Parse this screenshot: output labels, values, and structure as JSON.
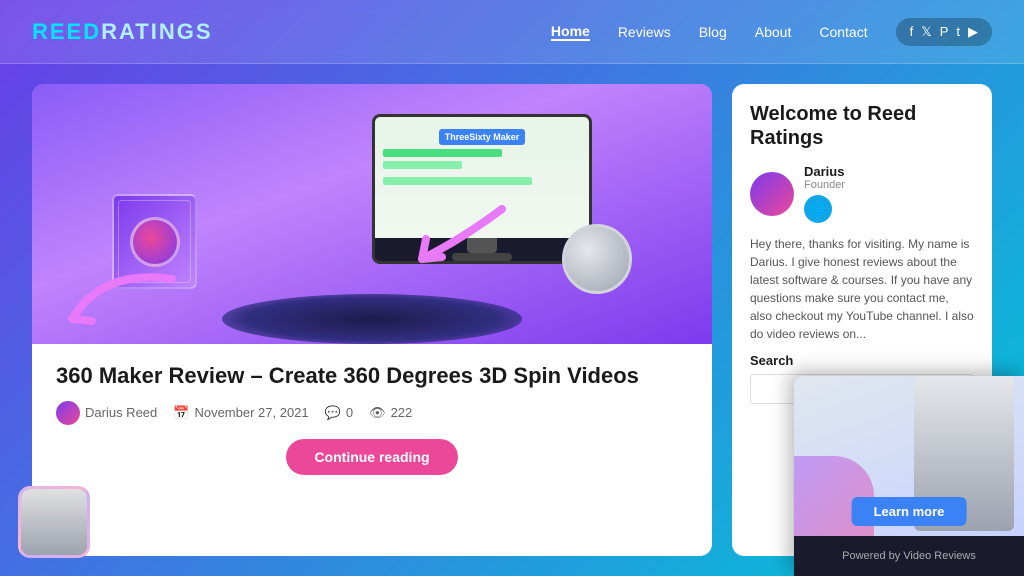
{
  "header": {
    "logo_text": "ReedRatings",
    "logo_part1": "Reed",
    "logo_part2": "Ratings",
    "nav": {
      "items": [
        {
          "label": "Home",
          "active": true
        },
        {
          "label": "Reviews",
          "active": false
        },
        {
          "label": "Blog",
          "active": false
        },
        {
          "label": "About",
          "active": false
        },
        {
          "label": "Contact",
          "active": false
        }
      ]
    },
    "social": [
      "f",
      "t",
      "𝐏",
      "t",
      "▶"
    ]
  },
  "article": {
    "title": "360 Maker Review – Create 360 Degrees 3D Spin Videos",
    "author": "Darius Reed",
    "date": "November 27, 2021",
    "comments": "0",
    "views": "222",
    "product_label": "ThreeSixty Maker",
    "continue_label": "Continue reading"
  },
  "sidebar": {
    "welcome_title": "Welcome to Reed Ratings",
    "author_name": "Darius",
    "author_role": "Founder",
    "body_text": "Hey there, thanks for visiting. My name is Darius. I give honest reviews about the latest software & courses. If you have any questions make sure you contact me, also checkout my YouTube channel. I also do video reviews on...",
    "search_label": "Search",
    "search_placeholder": ""
  },
  "video_popup": {
    "learn_more_label": "Learn more",
    "footer_label": "Powered by Video Reviews"
  }
}
